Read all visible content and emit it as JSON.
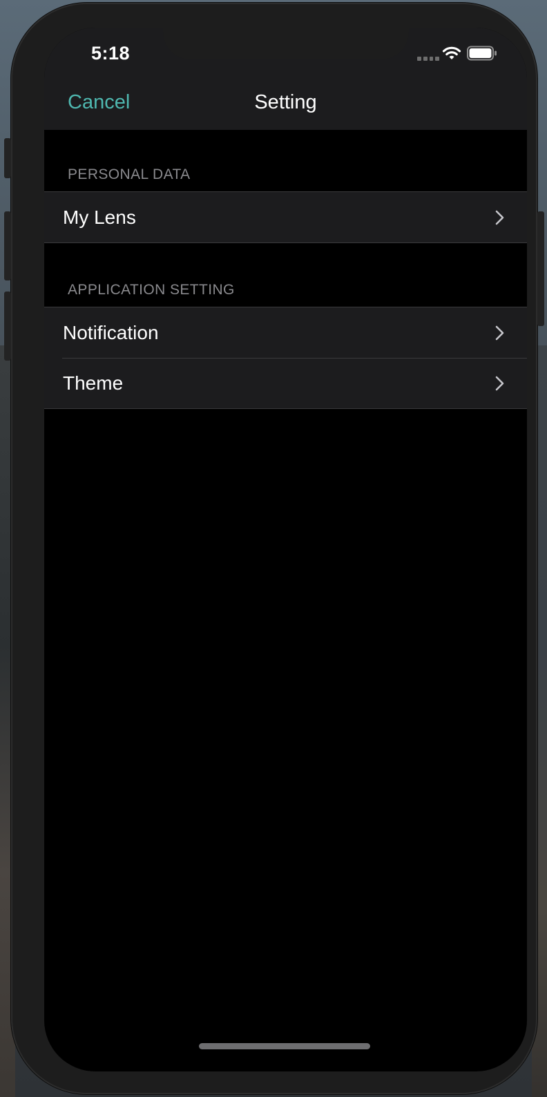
{
  "status_bar": {
    "time": "5:18",
    "signal_icon": "signal-dots-icon",
    "wifi_icon": "wifi-icon",
    "battery_icon": "battery-icon"
  },
  "nav": {
    "cancel_label": "Cancel",
    "title": "Setting"
  },
  "sections": {
    "personal": {
      "header": "PERSONAL DATA",
      "items": [
        {
          "label": "My Lens",
          "icon": "chevron-right-icon"
        }
      ]
    },
    "application": {
      "header": "APPLICATION SETTING",
      "items": [
        {
          "label": "Notification",
          "icon": "chevron-right-icon"
        },
        {
          "label": "Theme",
          "icon": "chevron-right-icon"
        }
      ]
    }
  },
  "colors": {
    "accent": "#4fb8b0",
    "background": "#000000",
    "cell_background": "#1c1c1e",
    "section_header_text": "#8a8a8e",
    "separator": "#3a3a3c"
  }
}
